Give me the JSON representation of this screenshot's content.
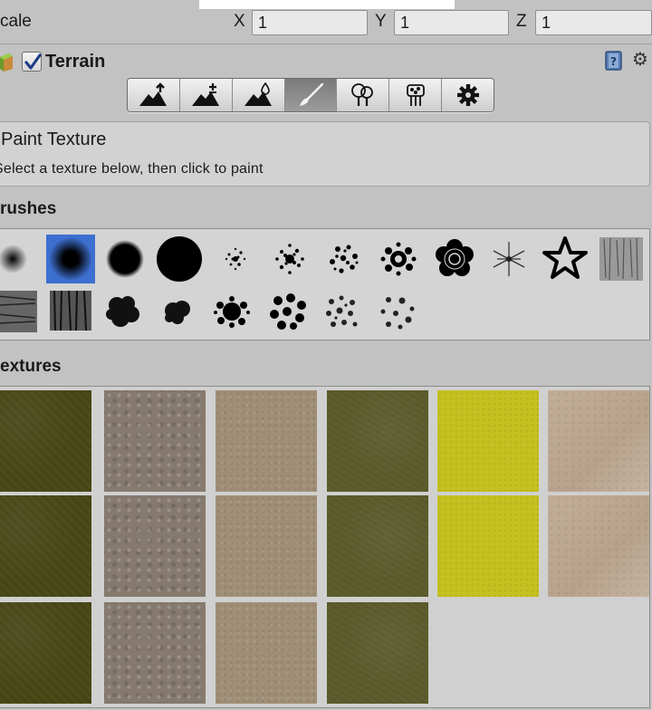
{
  "transform": {
    "scale_label": "cale",
    "x_label": "X",
    "x_value": "1",
    "y_label": "Y",
    "y_value": "1",
    "z_label": "Z",
    "z_value": "1"
  },
  "component": {
    "title": "Terrain",
    "enabled": true
  },
  "toolbar": {
    "tools": [
      {
        "name": "raise-lower-terrain",
        "icon": "mountain-up-arrow-icon"
      },
      {
        "name": "paint-height",
        "icon": "mountain-plus-icon"
      },
      {
        "name": "smooth-height",
        "icon": "mountain-drop-icon"
      },
      {
        "name": "paint-texture",
        "icon": "paintbrush-icon",
        "active": true
      },
      {
        "name": "place-trees",
        "icon": "trees-icon"
      },
      {
        "name": "paint-details",
        "icon": "flowers-icon"
      },
      {
        "name": "terrain-settings",
        "icon": "gear-icon"
      }
    ]
  },
  "paint_texture": {
    "title": "Paint Texture",
    "description": "Select a texture below, then click to paint"
  },
  "brushes": {
    "label": "rushes",
    "selected_index": 1,
    "count": 20
  },
  "textures": {
    "label": "extures",
    "selected_index": 4,
    "rows": [
      [
        "grass",
        "pebble",
        "sand",
        "moss",
        "yellow",
        "light"
      ],
      [
        "grass",
        "pebble",
        "sand",
        "moss",
        "yellow",
        "light"
      ],
      [
        "grass",
        "pebble",
        "sand",
        "moss"
      ]
    ]
  }
}
